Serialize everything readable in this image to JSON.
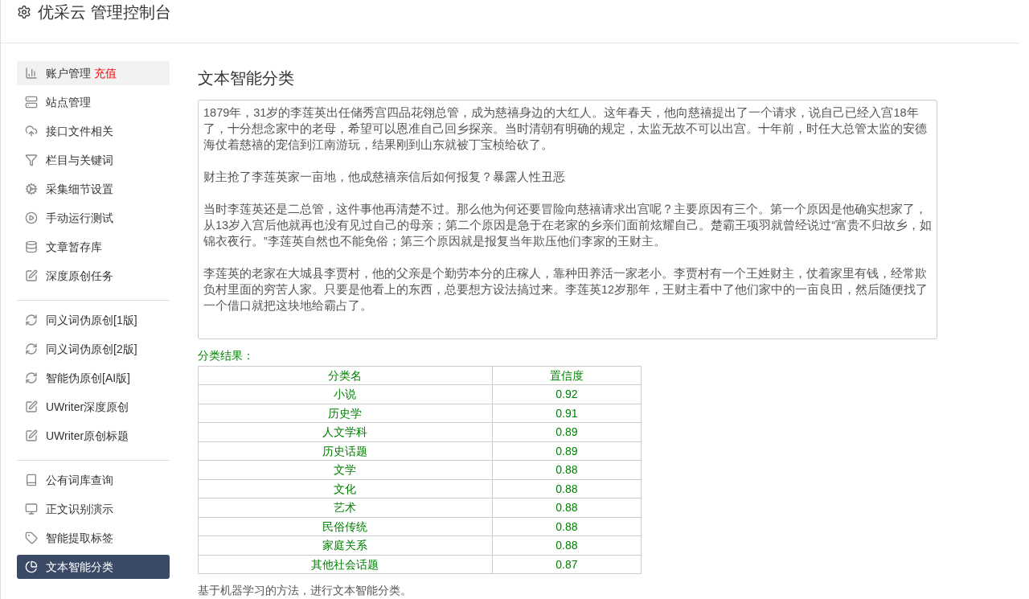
{
  "header": {
    "title": "优采云 管理控制台"
  },
  "sidebar": {
    "groups": [
      [
        {
          "label": "账户管理",
          "badge": "充值",
          "selected": false,
          "hover": true
        },
        {
          "label": "站点管理",
          "selected": false,
          "hover": false
        },
        {
          "label": "接口文件相关",
          "selected": false,
          "hover": false
        },
        {
          "label": "栏目与关键词",
          "selected": false,
          "hover": false
        },
        {
          "label": "采集细节设置",
          "selected": false,
          "hover": false
        },
        {
          "label": "手动运行测试",
          "selected": false,
          "hover": false
        },
        {
          "label": "文章暂存库",
          "selected": false,
          "hover": false
        },
        {
          "label": "深度原创任务",
          "selected": false,
          "hover": false
        }
      ],
      [
        {
          "label": "同义词伪原创[1版]",
          "selected": false,
          "hover": false
        },
        {
          "label": "同义词伪原创[2版]",
          "selected": false,
          "hover": false
        },
        {
          "label": "智能伪原创[AI版]",
          "selected": false,
          "hover": false
        },
        {
          "label": "UWriter深度原创",
          "selected": false,
          "hover": false
        },
        {
          "label": "UWriter原创标题",
          "selected": false,
          "hover": false
        }
      ],
      [
        {
          "label": "公有词库查询",
          "selected": false,
          "hover": false
        },
        {
          "label": "正文识别演示",
          "selected": false,
          "hover": false
        },
        {
          "label": "智能提取标签",
          "selected": false,
          "hover": false
        },
        {
          "label": "文本智能分类",
          "selected": true,
          "hover": false
        }
      ]
    ]
  },
  "main": {
    "title": "文本智能分类",
    "text_paragraphs": [
      "1879年，31岁的李莲英出任储秀宫四品花翎总管，成为慈禧身边的大红人。这年春天，他向慈禧提出了一个请求，说自己已经入宫18年了，十分想念家中的老母，希望可以恩准自己回乡探亲。当时清朝有明确的规定，太监无故不可以出宫。十年前，时任大总管太监的安德海仗着慈禧的宠信到江南游玩，结果刚到山东就被丁宝桢给砍了。",
      "财主抢了李莲英家一亩地，他成慈禧亲信后如何报复？暴露人性丑恶",
      "当时李莲英还是二总管，这件事他再清楚不过。那么他为何还要冒险向慈禧请求出宫呢？主要原因有三个。第一个原因是他确实想家了，从13岁入宫后他就再也没有见过自己的母亲；第二个原因是急于在老家的乡亲们面前炫耀自己。楚霸王项羽就曾经说过“富贵不归故乡，如锦衣夜行。”李莲英自然也不能免俗；第三个原因就是报复当年欺压他们李家的王财主。",
      "李莲英的老家在大城县李贾村，他的父亲是个勤劳本分的庄稼人，靠种田养活一家老小。李贾村有一个王姓财主，仗着家里有钱，经常欺负村里面的穷苦人家。只要是他看上的东西，总要想方设法搞过来。李莲英12岁那年，王财主看中了他们家中的一亩良田，然后随便找了一个借口就把这块地给霸占了。"
    ],
    "result_label": "分类结果：",
    "table": {
      "columns": [
        "分类名",
        "置信度"
      ],
      "rows": [
        [
          "小说",
          "0.92"
        ],
        [
          "历史学",
          "0.91"
        ],
        [
          "人文学科",
          "0.89"
        ],
        [
          "历史话题",
          "0.89"
        ],
        [
          "文学",
          "0.88"
        ],
        [
          "文化",
          "0.88"
        ],
        [
          "艺术",
          "0.88"
        ],
        [
          "民俗传统",
          "0.88"
        ],
        [
          "家庭关系",
          "0.88"
        ],
        [
          "其他社会话题",
          "0.87"
        ]
      ]
    },
    "note": "基于机器学习的方法，进行文本智能分类。"
  }
}
